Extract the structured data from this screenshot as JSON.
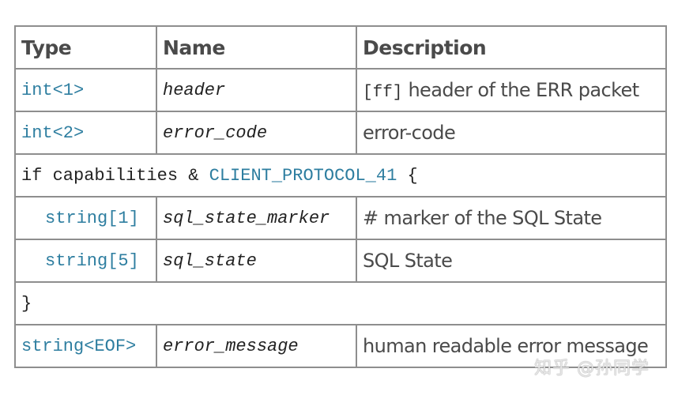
{
  "table": {
    "headers": [
      "Type",
      "Name",
      "Description"
    ],
    "rows": [
      {
        "type": "int<1>",
        "name": "header",
        "desc_code": "[ff]",
        "desc": " header of the ERR packet"
      },
      {
        "type": "int<2>",
        "name": "error_code",
        "desc": "error-code"
      },
      {
        "cond_prefix": "if capabilities & ",
        "cond_const": "CLIENT_PROTOCOL_41",
        "cond_suffix": " {"
      },
      {
        "type": "string[1]",
        "name": "sql_state_marker",
        "desc_code": "#",
        "desc": " marker of the SQL State"
      },
      {
        "type": "string[5]",
        "name": "sql_state",
        "desc": "SQL State"
      },
      {
        "close": "}"
      },
      {
        "type": "string<EOF>",
        "name": "error_message",
        "desc": "human readable error message"
      }
    ]
  },
  "watermark": "知乎 @孙同学",
  "colors": {
    "type_accent": "#2e7ea0",
    "border": "#8e8e8e",
    "text": "#4a4a4a"
  }
}
